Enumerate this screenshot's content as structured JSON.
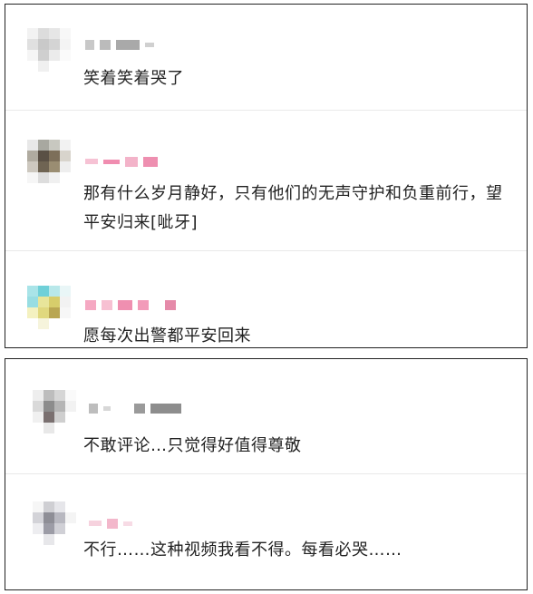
{
  "comments_top": [
    {
      "text": "笑着笑着哭了"
    },
    {
      "text": "那有什么岁月静好，只有他们的无声守护和负重前行，望平安归来[呲牙]"
    },
    {
      "text": "愿每次出警都平安回来"
    }
  ],
  "comments_bottom": [
    {
      "text": "不敢评论…只觉得好值得尊敬"
    },
    {
      "text": "不行……这种视频我看不得。每看必哭……"
    }
  ],
  "colors": {
    "text": "#222222",
    "border": "#222222",
    "divider": "#e9e9e9",
    "username_pink": "#f08db0",
    "username_gray": "#9a9a9a"
  }
}
